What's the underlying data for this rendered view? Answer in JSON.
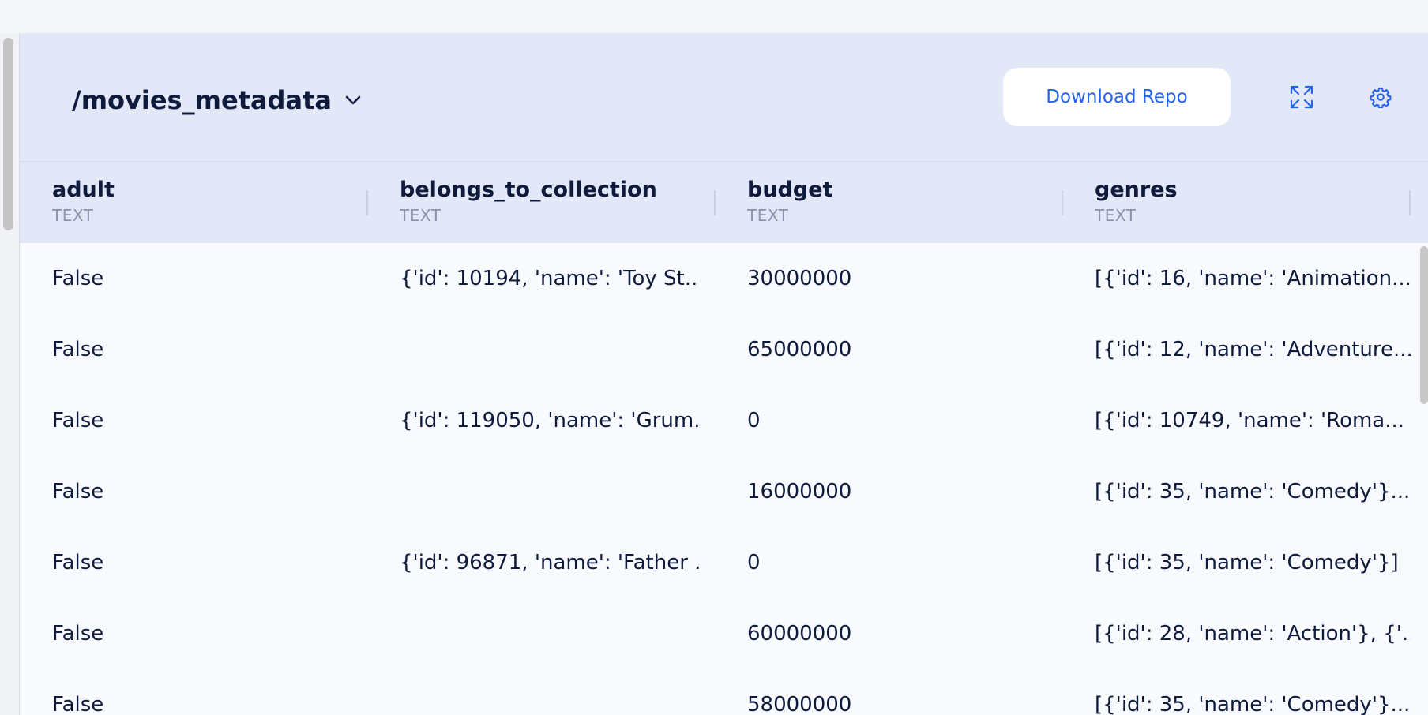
{
  "repo": {
    "title": "/movies_metadata"
  },
  "toolbar": {
    "download_label": "Download Repo",
    "expand_icon": "expand-icon",
    "settings_icon": "gear-icon"
  },
  "colors": {
    "accent": "#2563eb",
    "header_bg": "#e3e8f8",
    "text": "#0f1b3d",
    "type_text": "#8a93ad"
  },
  "table": {
    "columns": [
      {
        "name": "adult",
        "type": "TEXT"
      },
      {
        "name": "belongs_to_collection",
        "type": "TEXT"
      },
      {
        "name": "budget",
        "type": "TEXT"
      },
      {
        "name": "genres",
        "type": "TEXT"
      }
    ],
    "rows": [
      [
        "False",
        "{'id': 10194, 'name': 'Toy St...",
        "30000000",
        "[{'id': 16, 'name': 'Animation..."
      ],
      [
        "False",
        "",
        "65000000",
        "[{'id': 12, 'name': 'Adventure..."
      ],
      [
        "False",
        "{'id': 119050, 'name': 'Grum...",
        "0",
        "[{'id': 10749, 'name': 'Roma..."
      ],
      [
        "False",
        "",
        "16000000",
        "[{'id': 35, 'name': 'Comedy'}..."
      ],
      [
        "False",
        "{'id': 96871, 'name': 'Father ...",
        "0",
        "[{'id': 35, 'name': 'Comedy'}]"
      ],
      [
        "False",
        "",
        "60000000",
        "[{'id': 28, 'name': 'Action'}, {'..."
      ],
      [
        "False",
        "",
        "58000000",
        "[{'id': 35, 'name': 'Comedy'}..."
      ]
    ]
  }
}
